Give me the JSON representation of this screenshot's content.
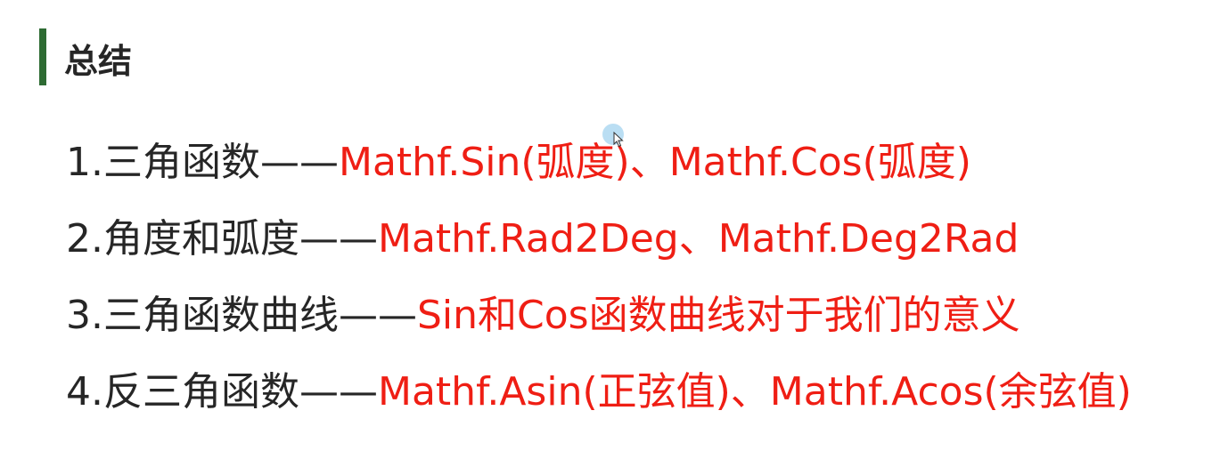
{
  "title": "总结",
  "items": [
    {
      "label": "1.三角函数——",
      "detail": "Mathf.Sin(弧度)、Mathf.Cos(弧度)"
    },
    {
      "label": "2.角度和弧度——",
      "detail": "Mathf.Rad2Deg、Mathf.Deg2Rad"
    },
    {
      "label": "3.三角函数曲线——",
      "detail": "Sin和Cos函数曲线对于我们的意义"
    },
    {
      "label": "4.反三角函数——",
      "detail": "Mathf.Asin(正弦值)、Mathf.Acos(余弦值)"
    }
  ],
  "colors": {
    "accent_bar": "#2e6b33",
    "text": "#262626",
    "highlight": "#ef1e14"
  },
  "icons": {
    "cursor": "mouse-pointer-icon"
  }
}
